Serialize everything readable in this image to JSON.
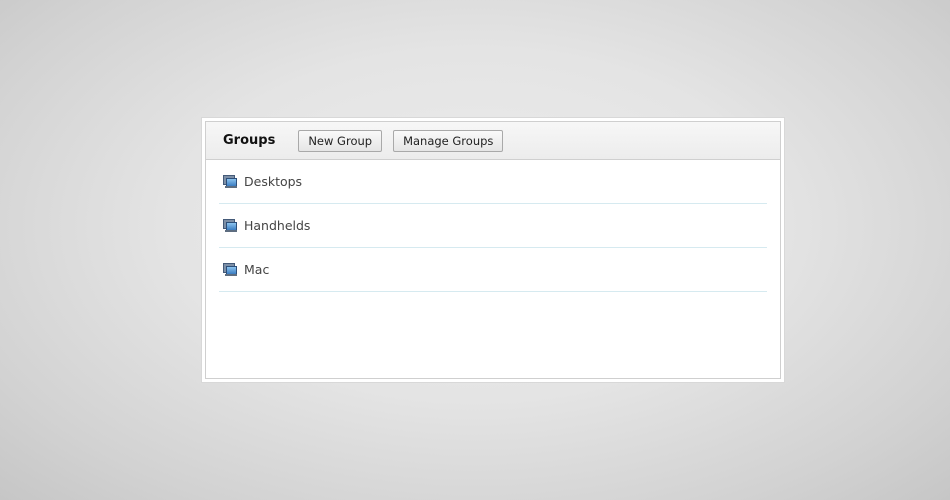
{
  "panel": {
    "title": "Groups",
    "buttons": {
      "new_group": "New Group",
      "manage_groups": "Manage Groups"
    }
  },
  "groups": [
    {
      "label": "Desktops",
      "icon": "computer-group-icon"
    },
    {
      "label": "Handhelds",
      "icon": "computer-group-icon"
    },
    {
      "label": "Mac",
      "icon": "computer-group-icon"
    }
  ],
  "colors": {
    "row_divider": "#d6eaf0",
    "label_text": "#444444"
  }
}
